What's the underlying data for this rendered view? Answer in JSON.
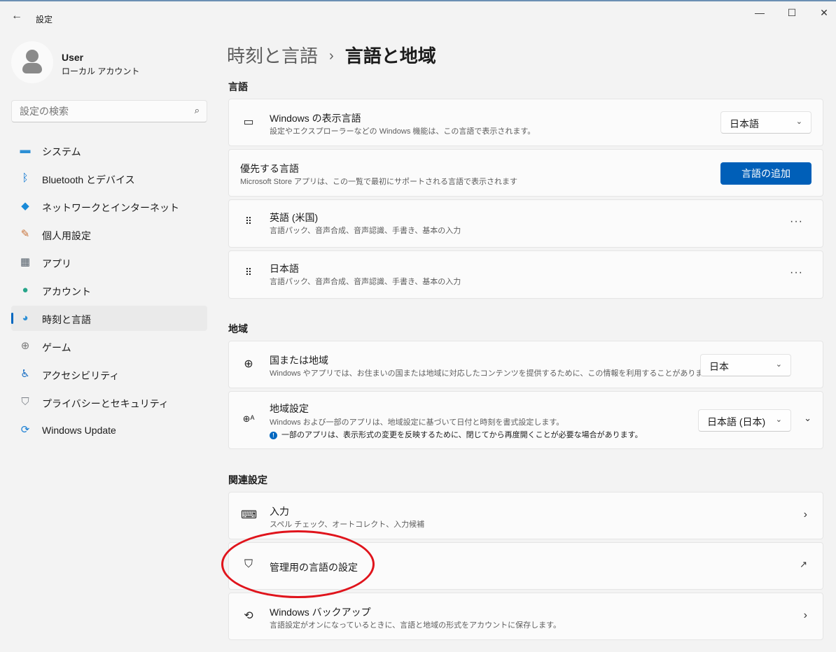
{
  "window": {
    "title": "設定",
    "back": "←",
    "minimize": "—",
    "maximize": "☐",
    "close": "✕"
  },
  "user": {
    "name": "User",
    "type": "ローカル アカウント"
  },
  "search": {
    "placeholder": "設定の検索",
    "icon": "⌕"
  },
  "sidebar": {
    "items": [
      {
        "label": "システム",
        "icon": "▬",
        "color": "#2d8fd5"
      },
      {
        "label": "Bluetooth とデバイス",
        "icon": "ᛒ",
        "color": "#0a74d0"
      },
      {
        "label": "ネットワークとインターネット",
        "icon": "◆",
        "color": "#1a8ad8"
      },
      {
        "label": "個人用設定",
        "icon": "✎",
        "color": "#c8733a"
      },
      {
        "label": "アプリ",
        "icon": "▦",
        "color": "#55606b"
      },
      {
        "label": "アカウント",
        "icon": "●",
        "color": "#27a58a"
      },
      {
        "label": "時刻と言語",
        "icon": "◕",
        "color": "#2d8fd5"
      },
      {
        "label": "ゲーム",
        "icon": "⊕",
        "color": "#7a7a7a"
      },
      {
        "label": "アクセシビリティ",
        "icon": "♿",
        "color": "#1a6fc4"
      },
      {
        "label": "プライバシーとセキュリティ",
        "icon": "⛉",
        "color": "#7a7f86"
      },
      {
        "label": "Windows Update",
        "icon": "⟳",
        "color": "#1a7fd4"
      }
    ],
    "selected": 6
  },
  "header": {
    "parent": "時刻と言語",
    "sep": "›",
    "current": "言語と地域"
  },
  "language": {
    "heading": "言語",
    "display": {
      "title": "Windows の表示言語",
      "desc": "設定やエクスプローラーなどの Windows 機能は、この言語で表示されます。",
      "value": "日本語"
    },
    "preferred": {
      "title": "優先する言語",
      "desc": "Microsoft Store アプリは、この一覧で最初にサポートされる言語で表示されます",
      "button": "言語の追加"
    },
    "list": [
      {
        "title": "英語 (米国)",
        "desc": "言語パック、音声合成、音声認識、手書き、基本の入力"
      },
      {
        "title": "日本語",
        "desc": "言語パック、音声合成、音声認識、手書き、基本の入力"
      }
    ]
  },
  "region": {
    "heading": "地域",
    "country": {
      "title": "国または地域",
      "desc": "Windows やアプリでは、お住まいの国または地域に対応したコンテンツを提供するために、この情報を利用することがあります",
      "value": "日本"
    },
    "format": {
      "title": "地域設定",
      "desc": "Windows および一部のアプリは、地域設定に基づいて日付と時刻を書式設定します。",
      "note": "一部のアプリは、表示形式の変更を反映するために、閉じてから再度開くことが必要な場合があります。",
      "value": "日本語 (日本)"
    }
  },
  "related": {
    "heading": "関連設定",
    "items": [
      {
        "title": "入力",
        "desc": "スペル チェック、オートコレクト、入力候補"
      },
      {
        "title": "管理用の言語の設定"
      },
      {
        "title": "Windows バックアップ",
        "desc": "言語設定がオンになっているときに、言語と地域の形式をアカウントに保存します。"
      }
    ]
  },
  "annotation_color": "#e0141c"
}
